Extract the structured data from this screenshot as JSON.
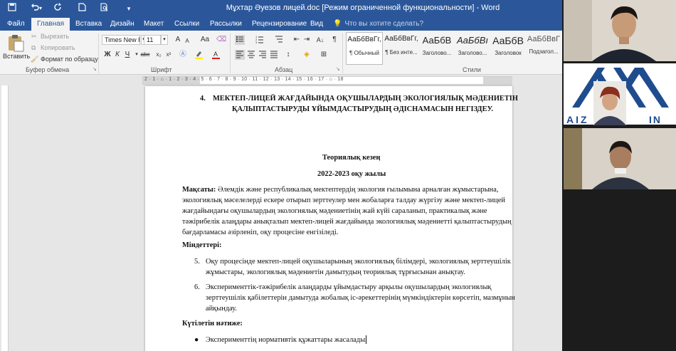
{
  "titlebar": {
    "document_title": "Мұхтар Әуезов лицей.doc [Режим ограниченной функциональности] - Word",
    "qat_icons": [
      "save-icon",
      "undo-icon",
      "redo-icon",
      "new-doc-icon",
      "print-preview-icon",
      "more-icon"
    ]
  },
  "tabs": [
    {
      "label": "Файл",
      "active": false
    },
    {
      "label": "Главная",
      "active": true
    },
    {
      "label": "Вставка",
      "active": false
    },
    {
      "label": "Дизайн",
      "active": false
    },
    {
      "label": "Макет",
      "active": false
    },
    {
      "label": "Ссылки",
      "active": false
    },
    {
      "label": "Рассылки",
      "active": false
    },
    {
      "label": "Рецензирование",
      "active": false
    },
    {
      "label": "Вид",
      "active": false
    }
  ],
  "tell_me": "Что вы хотите сделать?",
  "ribbon": {
    "clipboard": {
      "paste_label": "Вставить",
      "cut_label": "Вырезать",
      "copy_label": "Копировать",
      "format_painter_label": "Формат по образцу",
      "group_label": "Буфер обмена"
    },
    "font": {
      "font_name": "Times New R",
      "font_size": "11",
      "group_label": "Шрифт",
      "bold": "Ж",
      "italic": "К",
      "underline": "Ч",
      "strike": "abc",
      "subscript": "x₂",
      "superscript": "x²",
      "grow": "A",
      "shrink": "A",
      "case": "Aa"
    },
    "paragraph": {
      "group_label": "Абзац"
    },
    "styles": {
      "group_label": "Стили",
      "items": [
        {
          "sample": "АаБбВвГг,",
          "name": "¶ Обычный",
          "selected": true
        },
        {
          "sample": "АаБбВвГг,",
          "name": "¶ Без инте...",
          "selected": false
        },
        {
          "sample": "АаБбВ",
          "name": "Заголово...",
          "selected": false
        },
        {
          "sample": "АаБбВı",
          "name": "Заголово...",
          "selected": false
        },
        {
          "sample": "АаБбВ",
          "name": "Заголовок",
          "selected": false
        },
        {
          "sample": "АаБбВвГ",
          "name": "Подзагол...",
          "selected": false
        }
      ]
    }
  },
  "ruler_marks": "2 · 1 · ⌂ · 1 · 2 · 3 · 4 · 5 · 6 · 7 · 8 · 9 · 10 · 11 · 12 · 13 · 14 · 15 · 16 · 17 · ⌂ · 18",
  "document": {
    "heading_num": "4.",
    "heading_line1": "МЕКТЕП-ЛИЦЕЙ ЖАҒДАЙЫНДА ОҚУШЫЛАРДЫҢ ЭКОЛОГИЯЛЫҚ МӘДЕНИЕТІН",
    "heading_line2": "ҚАЛЫПТАСТЫРУДЫ ҰЙЫМДАСТЫРУДЫҢ ӘДІСНАМАСЫН НЕГІЗДЕУ.",
    "stage": "Теориялық кезең",
    "year": "2022-2023 оқу жылы",
    "goal_label": "Мақсаты:",
    "goal_lines": [
      " Әлемдік және республикалық мектептердің экология ғылымына арналған жұмыстарына,",
      "экологиялық мәселелерді ескере отырып зерттеулер мен жобаларға талдау жүргізу және мектеп-лицей",
      "жағдайындағы оқушылардың экологиялық мәдениетінің жай күйі сараланып, практикалық және",
      "тәжірибелік алаңдары анықталып мектеп-лицей жағдайында экологиялық мәдениетті қалыптастырудың",
      "бағдарламасы әзірленіп, оқу процесіне енгізіледі."
    ],
    "tasks_label": "Міндеттері:",
    "tasks": [
      {
        "num": "5.",
        "lines": [
          "Оқу процесінде мектеп-лицей оқушыларының экологиялық білімдері, экологиялық зерттеушілік",
          "жұмыстары, экологиялық мәдениетін дамытудың теориялық тұрғысынан анықтау."
        ]
      },
      {
        "num": "6.",
        "lines": [
          "Эксперименттік-тәжірибелік алаңдарды ұйымдастыру арқылы оқушылардың экологиялық",
          "зерттеушілік қабілеттерін дамытуда жобалық іс-әрекеттерінің мүмкіндіктерін көрсетіп, мазмұнын",
          "айқындау."
        ]
      }
    ],
    "expected_label": "Күтілетін нәтиже:",
    "bullets": [
      "Эксперименттің нормативтік құжаттары жасалады."
    ]
  },
  "video_tiles": [
    {
      "name": "",
      "bg": "#d9d4cc"
    },
    {
      "name": "",
      "bg": "#ffffff",
      "logo_text": "AIZ    ... IN"
    },
    {
      "name": "",
      "bg": "#cfc9c0"
    }
  ],
  "colors": {
    "word_blue": "#2b579a",
    "ribbon_bg": "#f3f3f3",
    "workspace_bg": "#e6e6e6",
    "logo_blue": "#1f4c8f"
  }
}
